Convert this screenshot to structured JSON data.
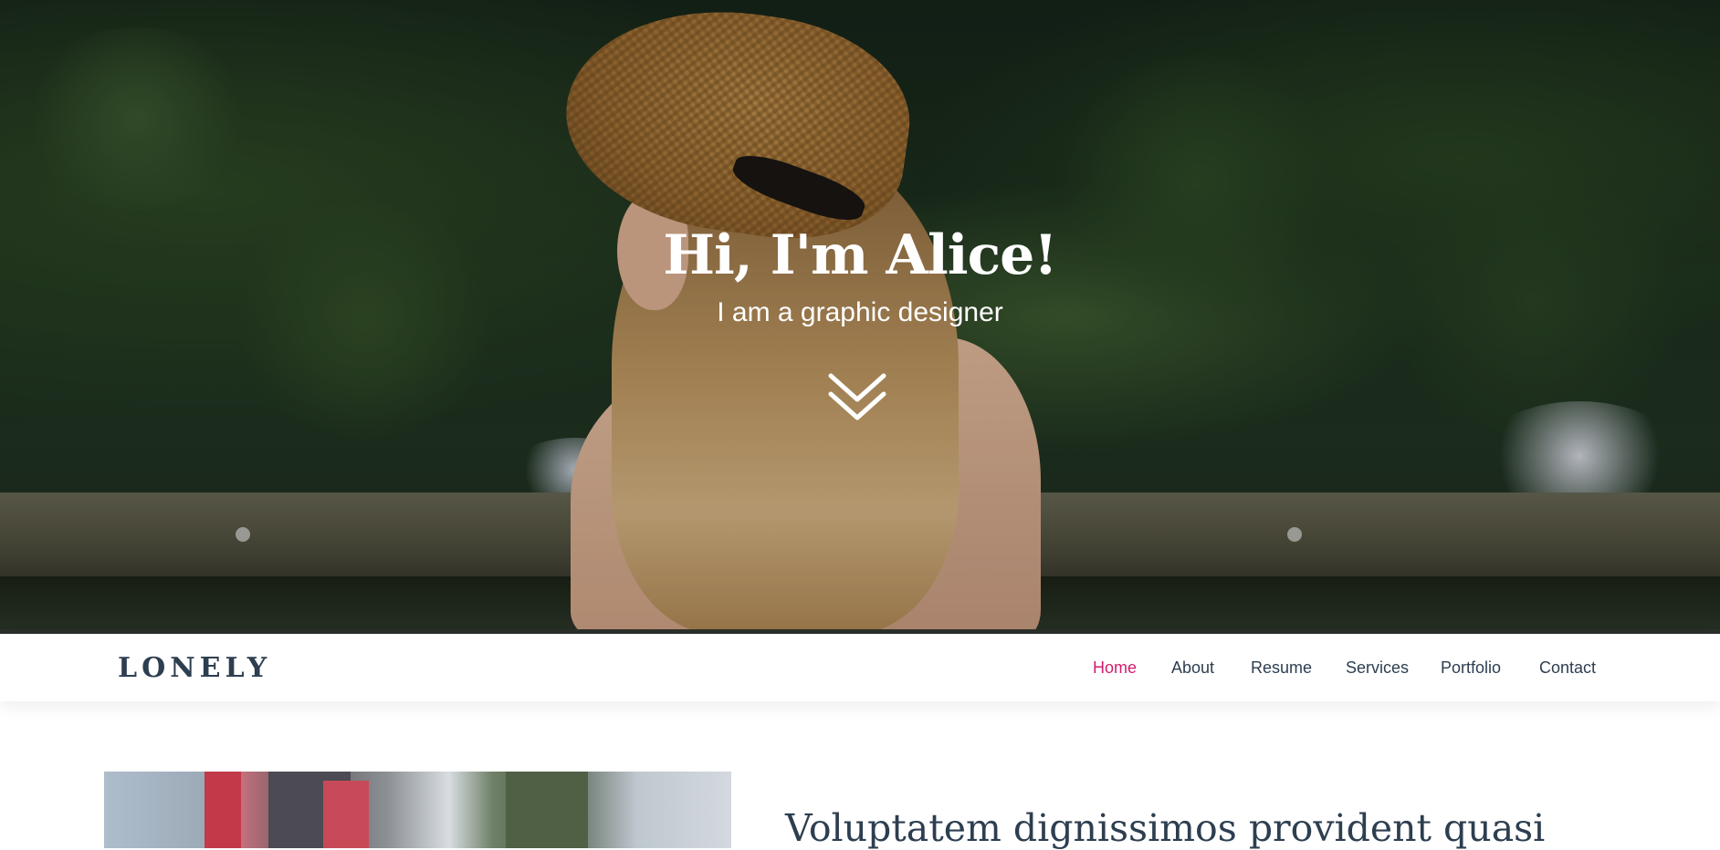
{
  "hero": {
    "title": "Hi, I'm Alice!",
    "subtitle": "I am a graphic designer",
    "scroll_icon": "double-chevron-down-icon"
  },
  "navbar": {
    "logo": "LONELY",
    "items": [
      {
        "label": "Home",
        "active": true
      },
      {
        "label": "About",
        "active": false
      },
      {
        "label": "Resume",
        "active": false
      },
      {
        "label": "Services",
        "active": false
      },
      {
        "label": "Portfolio",
        "active": false
      },
      {
        "label": "Contact",
        "active": false
      }
    ]
  },
  "about": {
    "heading": "Voluptatem dignissimos provident quasi"
  },
  "colors": {
    "accent": "#d11d70",
    "text_dark": "#2d3e50",
    "hero_text": "#ffffff",
    "nav_background": "#ffffff"
  }
}
